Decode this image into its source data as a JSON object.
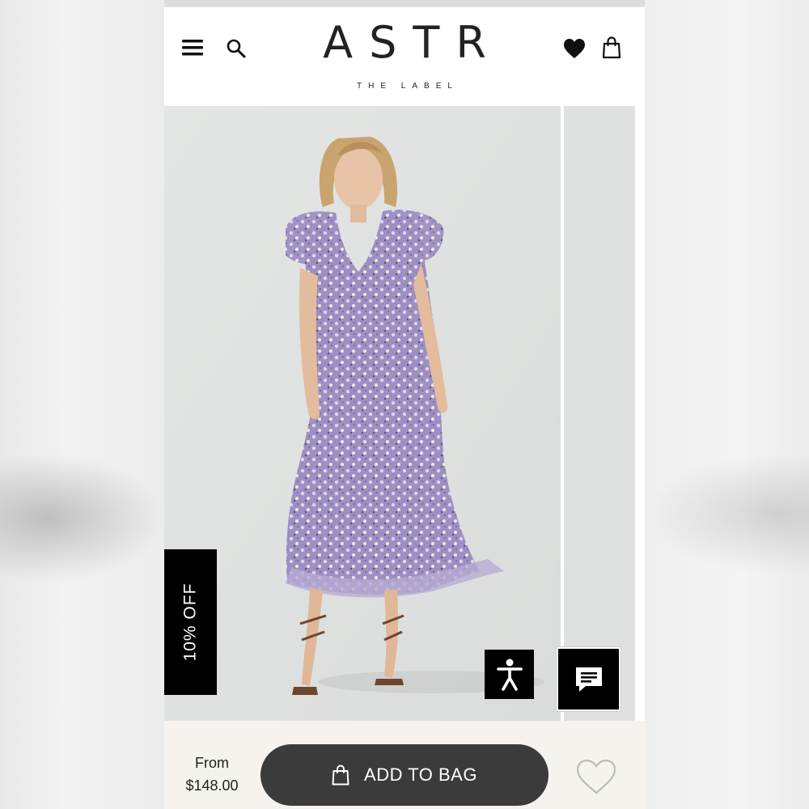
{
  "brand": {
    "logo_text": "ASTR",
    "tagline": "THE LABEL"
  },
  "header": {
    "icons": [
      "menu-icon",
      "search-icon",
      "heart-icon",
      "shopping-bag-icon"
    ]
  },
  "gallery": {
    "image_description": "Model wearing lavender floral ruffle-sleeve midi dress",
    "badge_text": "10% OFF"
  },
  "floating": {
    "accessibility_icon": "accessibility-icon",
    "chat_icon": "chat-icon"
  },
  "purchase_bar": {
    "price_prefix": "From",
    "price": "$148.00",
    "add_to_bag_label": "ADD TO BAG",
    "wishlist_icon": "heart-outline-icon"
  },
  "colors": {
    "button_bg": "#3b3b3b",
    "footer_bg": "#f6f3ef",
    "badge_bg": "#000000",
    "dress_lavender": "#a99acb"
  }
}
